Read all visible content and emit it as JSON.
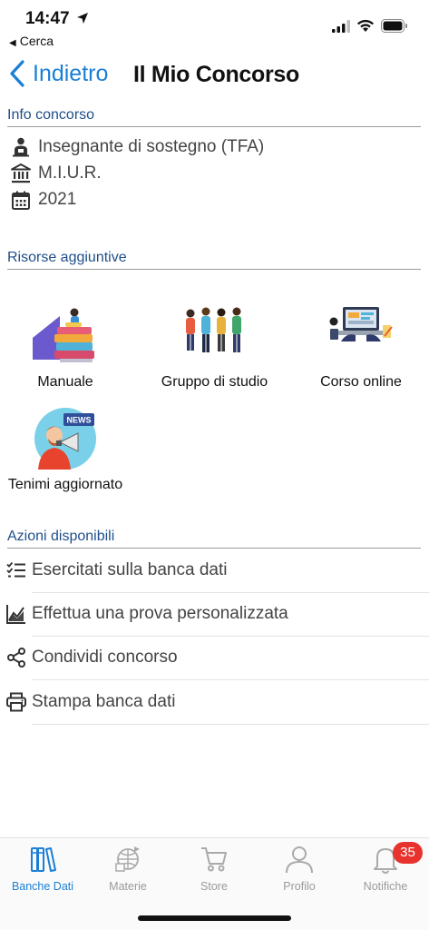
{
  "status_bar": {
    "time": "14:47",
    "back_app": "Cerca"
  },
  "nav": {
    "back_label": "Indietro",
    "title": "Il Mio Concorso"
  },
  "info_section": {
    "header": "Info concorso",
    "items": [
      {
        "icon": "person-board-icon",
        "text": "Insegnante di sostegno (TFA)"
      },
      {
        "icon": "bank-icon",
        "text": "M.I.U.R."
      },
      {
        "icon": "calendar-icon",
        "text": "2021"
      }
    ]
  },
  "resources_section": {
    "header": "Risorse aggiuntive",
    "items": [
      {
        "label": "Manuale",
        "art": "books-illustration"
      },
      {
        "label": "Gruppo di studio",
        "art": "students-illustration"
      },
      {
        "label": "Corso online",
        "art": "laptop-illustration"
      },
      {
        "label": "Tenimi aggiornato",
        "art": "news-megaphone-illustration"
      }
    ]
  },
  "actions_section": {
    "header": "Azioni disponibili",
    "items": [
      {
        "label": "Esercitati sulla banca dati",
        "icon": "checklist-icon"
      },
      {
        "label": "Effettua una prova personalizzata",
        "icon": "chart-icon"
      },
      {
        "label": "Condividi concorso",
        "icon": "share-icon"
      },
      {
        "label": "Stampa banca dati",
        "icon": "printer-icon"
      }
    ]
  },
  "tabbar": {
    "tabs": [
      {
        "label": "Banche Dati",
        "icon": "books-tab-icon",
        "active": true
      },
      {
        "label": "Materie",
        "icon": "subjects-tab-icon",
        "active": false
      },
      {
        "label": "Store",
        "icon": "cart-tab-icon",
        "active": false
      },
      {
        "label": "Profilo",
        "icon": "profile-tab-icon",
        "active": false
      },
      {
        "label": "Notifiche",
        "icon": "bell-tab-icon",
        "active": false
      }
    ],
    "notification_badge": "35"
  },
  "colors": {
    "accent": "#1a7fd6",
    "section_header": "#1f4f8a",
    "badge": "#e8322d"
  }
}
